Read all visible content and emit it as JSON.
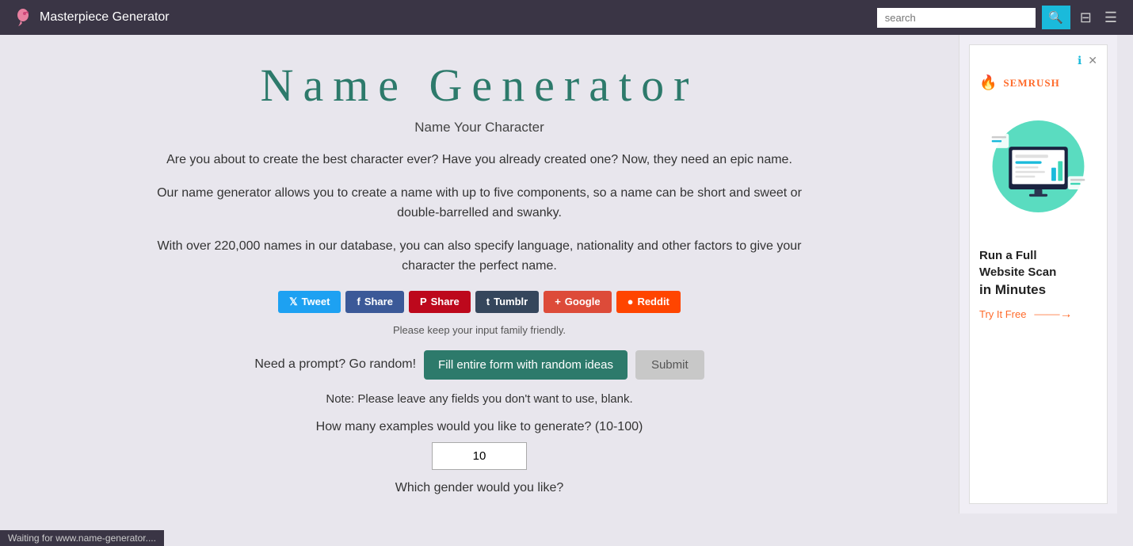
{
  "header": {
    "site_title": "Masterpiece Generator",
    "search_placeholder": "search",
    "search_icon": "🔍",
    "sliders_icon": "⊞",
    "menu_icon": "☰"
  },
  "page": {
    "title": "Name Generator",
    "subtitle": "Name Your Character",
    "description_1": "Are you about to create the best character ever? Have you already created one? Now, they need an epic name.",
    "description_2": "Our name generator allows you to create a name with up to five components, so a name can be short and sweet or double-barrelled and swanky.",
    "description_3": "With over 220,000 names in our database, you can also specify language, nationality and other factors to give your character the perfect name."
  },
  "social": {
    "tweet_label": "Tweet",
    "facebook_label": "Share",
    "pinterest_label": "Share",
    "tumblr_label": "Tumblr",
    "google_label": "Google",
    "reddit_label": "Reddit"
  },
  "form": {
    "family_notice": "Please keep your input family friendly.",
    "prompt_text": "Need a prompt? Go random!",
    "fill_random_label": "Fill entire form with random ideas",
    "submit_label": "Submit",
    "note_text": "Note: Please leave any fields you don't want to use, blank.",
    "examples_label": "How many examples would you like to generate? (10-100)",
    "examples_value": "10",
    "gender_label": "Which gender would you like?"
  },
  "ad": {
    "headline_line1": "Run a Full",
    "headline_line2": "Website Scan",
    "headline_line3": "in Minutes",
    "cta_text": "Try It Free",
    "semrush_text": "SEMRUSH"
  },
  "status_bar": {
    "text": "Waiting for www.name-generator...."
  }
}
